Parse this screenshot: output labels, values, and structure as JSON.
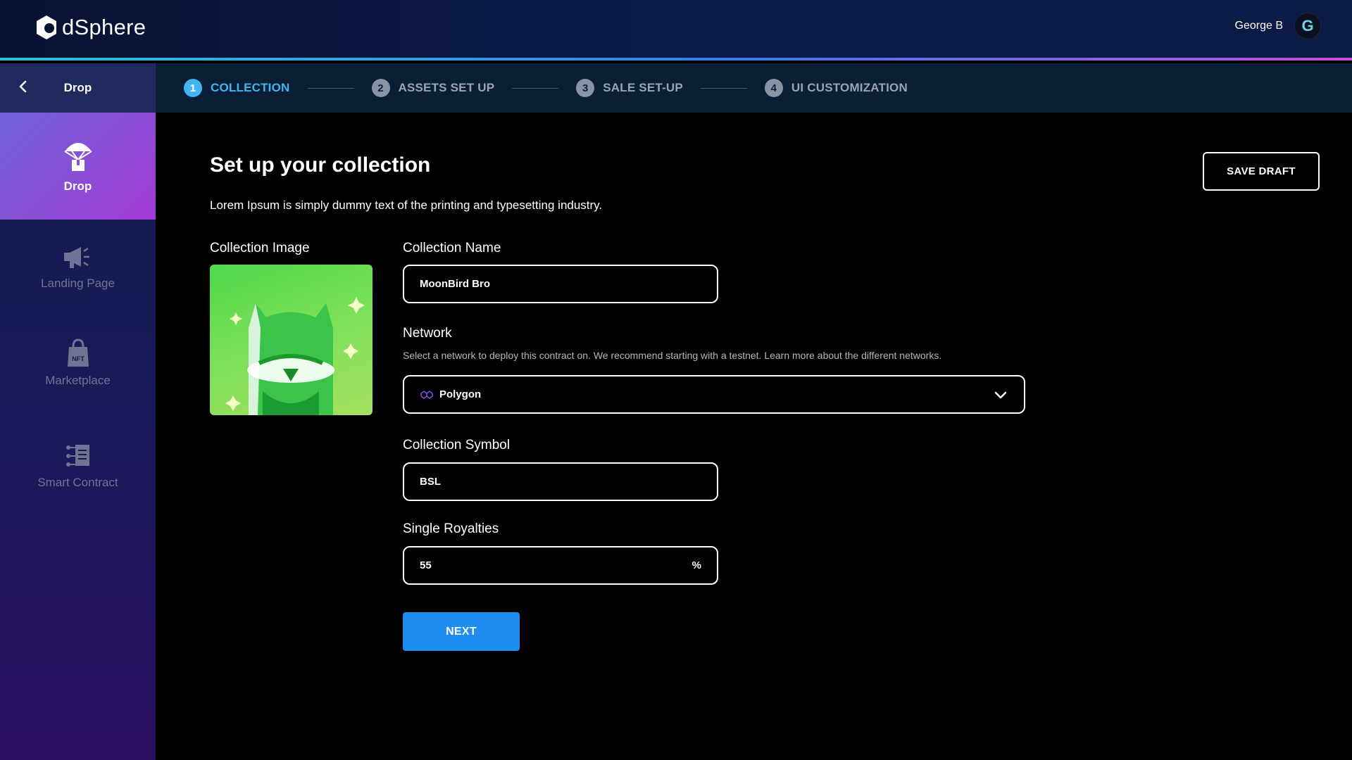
{
  "header": {
    "logo_text": "dSphere",
    "user_name": "George B",
    "avatar_initial": "G"
  },
  "sidebar": {
    "back_title": "Drop",
    "items": [
      {
        "label": "Drop",
        "icon": "parachute-box-icon",
        "active": true
      },
      {
        "label": "Landing Page",
        "icon": "megaphone-icon",
        "active": false
      },
      {
        "label": "Marketplace",
        "icon": "nft-bag-icon",
        "active": false
      },
      {
        "label": "Smart Contract",
        "icon": "contract-document-icon",
        "active": false
      }
    ]
  },
  "stepper": {
    "steps": [
      {
        "num": "1",
        "label": "COLLECTION",
        "active": true
      },
      {
        "num": "2",
        "label": "ASSETS SET UP",
        "active": false
      },
      {
        "num": "3",
        "label": "SALE SET-UP",
        "active": false
      },
      {
        "num": "4",
        "label": "UI CUSTOMIZATION",
        "active": false
      }
    ]
  },
  "main": {
    "title": "Set up your collection",
    "subtitle": "Lorem Ipsum is simply dummy text of the printing and typesetting industry.",
    "save_draft": "SAVE DRAFT",
    "collection_image_label": "Collection Image",
    "collection_name_label": "Collection Name",
    "collection_name_value": "MoonBird Bro",
    "network_label": "Network",
    "network_help": "Select a network to deploy this contract on. We recommend starting with a testnet. Learn more about the different networks.",
    "network_value": "Polygon",
    "symbol_label": "Collection Symbol",
    "symbol_value": "BSL",
    "royalties_label": "Single Royalties",
    "royalties_value": "55",
    "royalties_suffix": "%",
    "next": "NEXT"
  },
  "colors": {
    "accent_blue": "#3fb6f0",
    "button_blue": "#1f8cf0",
    "sidebar_active": "#a23bd6",
    "polygon_purple": "#8247e5"
  }
}
